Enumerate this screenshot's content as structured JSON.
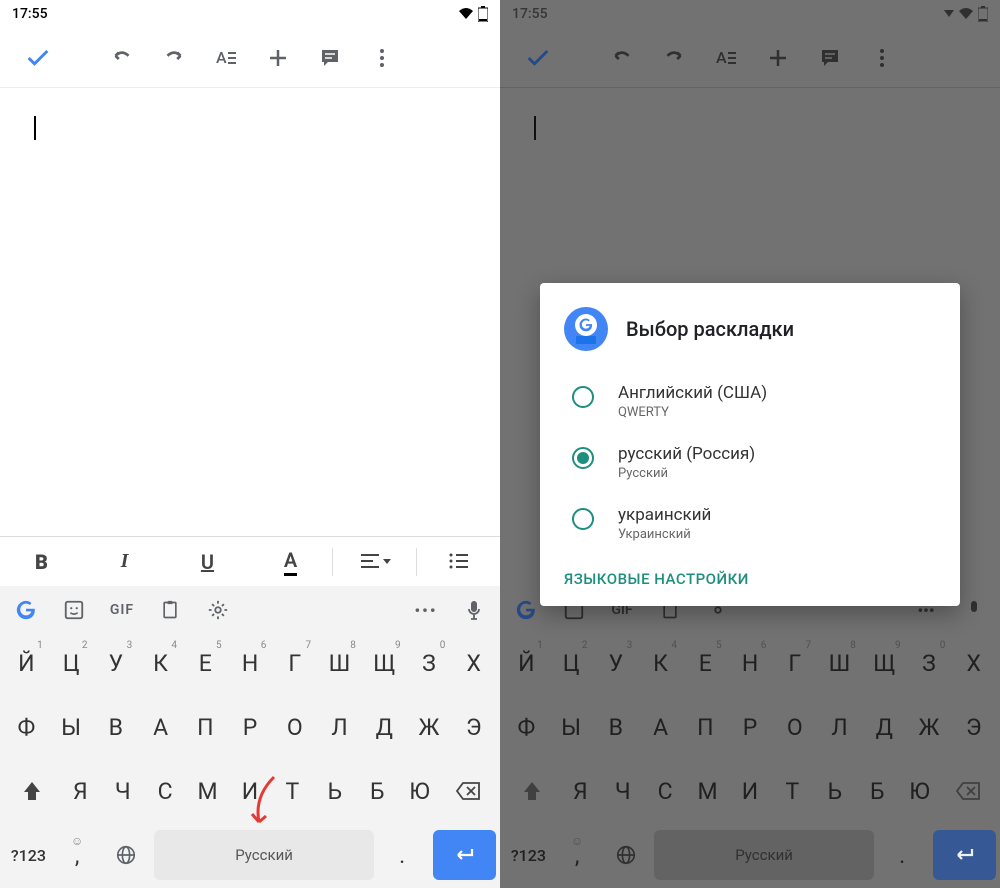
{
  "statusbar": {
    "time": "17:55"
  },
  "toolbar": {
    "check": "✓",
    "undo": "↶",
    "redo": "↷",
    "format": "A≡",
    "plus": "+",
    "comment": "💬",
    "more": "⋮"
  },
  "fmtbar": {
    "bold": "B",
    "italic": "I",
    "underline": "U",
    "textcolor": "A",
    "align": "≡",
    "bullets": "≡"
  },
  "kbd_top": {
    "google": "G",
    "sticker": "☺",
    "gif": "GIF",
    "clipboard": "📋",
    "settings": "⚙",
    "dots": "•••",
    "mic": "🎤"
  },
  "keyboard": {
    "row1": [
      {
        "k": "Й",
        "h": "1"
      },
      {
        "k": "Ц",
        "h": "2"
      },
      {
        "k": "У",
        "h": "3"
      },
      {
        "k": "К",
        "h": "4"
      },
      {
        "k": "Е",
        "h": "5"
      },
      {
        "k": "Н",
        "h": "6"
      },
      {
        "k": "Г",
        "h": "7"
      },
      {
        "k": "Ш",
        "h": "8"
      },
      {
        "k": "Щ",
        "h": "9"
      },
      {
        "k": "З",
        "h": "0"
      },
      {
        "k": "Х",
        "h": ""
      }
    ],
    "row2": [
      {
        "k": "Ф"
      },
      {
        "k": "Ы"
      },
      {
        "k": "В"
      },
      {
        "k": "А"
      },
      {
        "k": "П"
      },
      {
        "k": "Р"
      },
      {
        "k": "О"
      },
      {
        "k": "Л"
      },
      {
        "k": "Д"
      },
      {
        "k": "Ж"
      },
      {
        "k": "Э"
      }
    ],
    "row3": [
      {
        "k": "⇧",
        "special": true
      },
      {
        "k": "Я"
      },
      {
        "k": "Ч"
      },
      {
        "k": "С"
      },
      {
        "k": "М"
      },
      {
        "k": "И"
      },
      {
        "k": "Т"
      },
      {
        "k": "Ь"
      },
      {
        "k": "Б"
      },
      {
        "k": "Ю"
      },
      {
        "k": "⌫",
        "special": true
      }
    ],
    "sym": "?123",
    "emoji": "☺",
    "globe": "🌐",
    "space": "Русский",
    "period": ".",
    "enter": "↵"
  },
  "dialog": {
    "title": "Выбор раскладки",
    "options": [
      {
        "label": "Английский (США)",
        "sub": "QWERTY",
        "selected": false
      },
      {
        "label": "русский (Россия)",
        "sub": "Русский",
        "selected": true
      },
      {
        "label": "украинский",
        "sub": "Украинский",
        "selected": false
      }
    ],
    "link": "ЯЗЫКОВЫЕ НАСТРОЙКИ"
  }
}
